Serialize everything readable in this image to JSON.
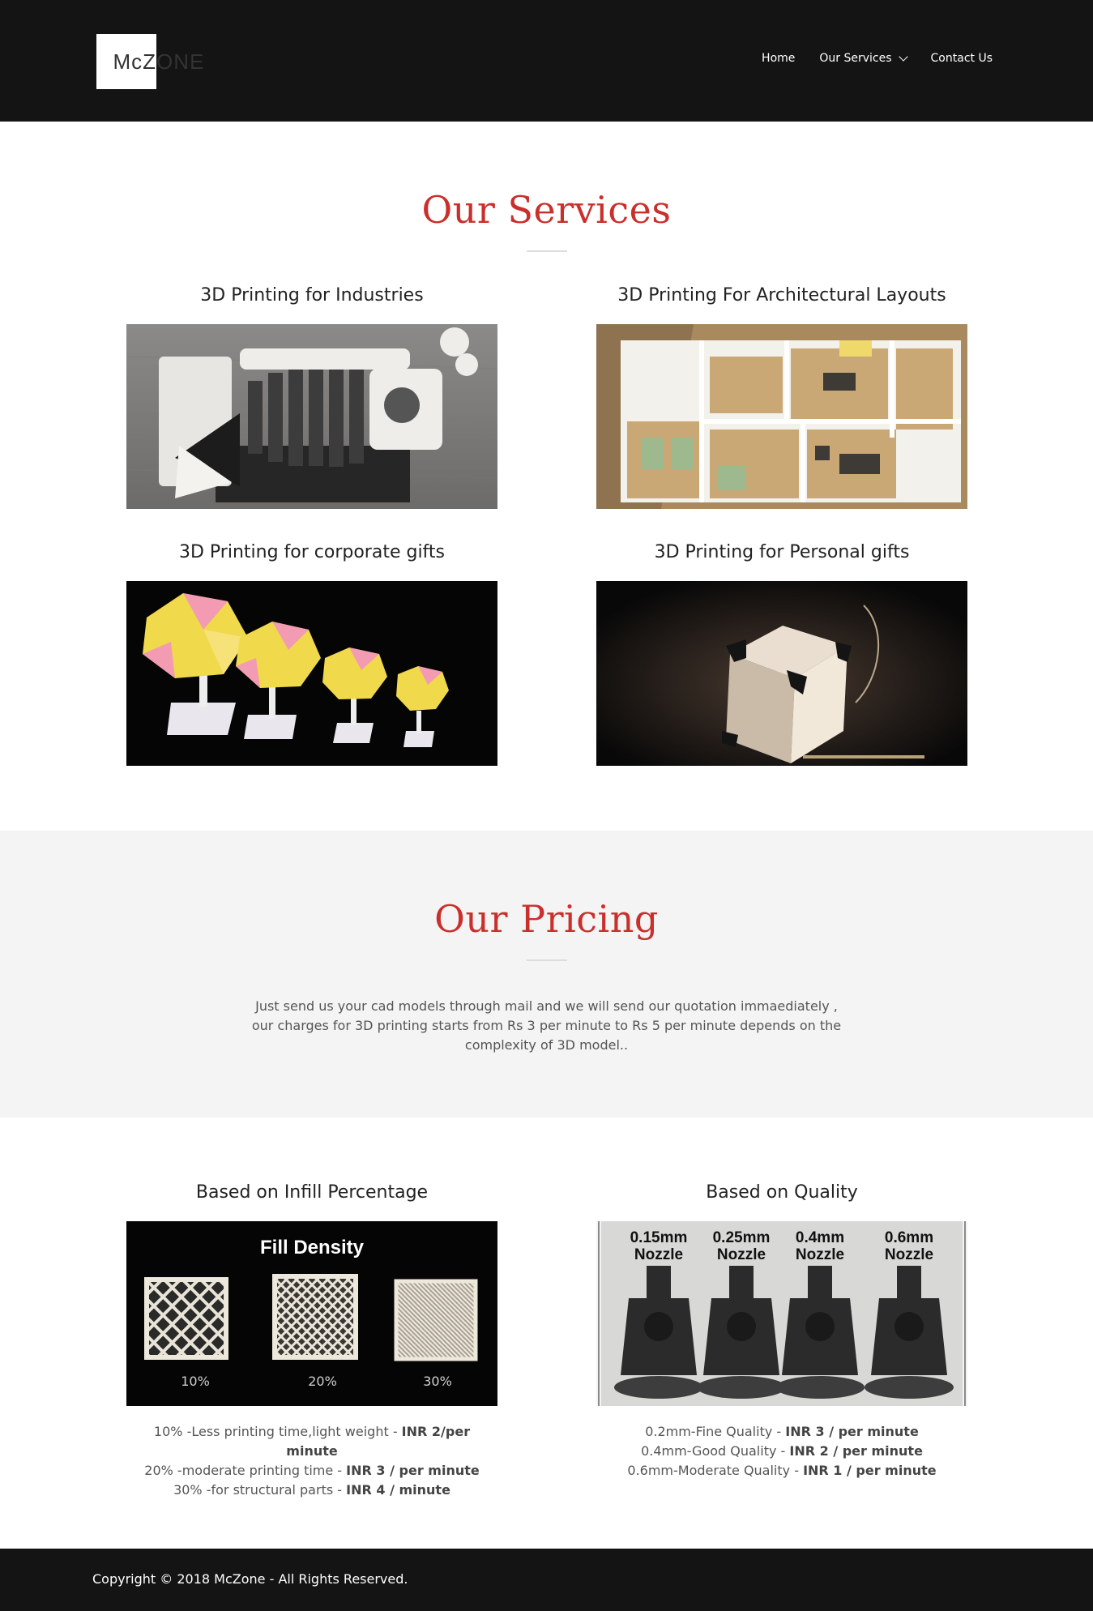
{
  "brand": {
    "logo_left": "McZ",
    "logo_right": "ONE"
  },
  "nav": {
    "home": "Home",
    "services": "Our Services",
    "contact": "Contact Us"
  },
  "services": {
    "title": "Our Services",
    "items": [
      {
        "title": "3D Printing for Industries",
        "image": "jet-engine-model"
      },
      {
        "title": "3D Printing For Architectural Layouts",
        "image": "floor-plan-model"
      },
      {
        "title": "3D Printing for corporate gifts",
        "image": "trophies"
      },
      {
        "title": "3D Printing for Personal gifts",
        "image": "lithophane-lamp"
      }
    ]
  },
  "pricing": {
    "title": "Our Pricing",
    "text": "Just send us your cad models through mail and we will send our quotation immaediately , our charges for 3D printing starts from Rs 3 per minute to Rs 5 per minute depends on the complexity of 3D model.."
  },
  "plans": {
    "infill": {
      "title": "Based on Infill Percentage",
      "image": {
        "heading": "Fill Density",
        "samples": [
          "10%",
          "20%",
          "30%"
        ]
      },
      "rows": [
        {
          "text": "10% -Less printing time,light weight - ",
          "price": "INR 2/per minute"
        },
        {
          "text": "20% -moderate printing time - ",
          "price": "INR 3 / per minute"
        },
        {
          "text": "30% -for structural parts - ",
          "price": "INR 4 / minute"
        }
      ]
    },
    "quality": {
      "title": "Based on Quality",
      "image": {
        "nozzles": [
          {
            "size": "0.15mm",
            "label": "Nozzle"
          },
          {
            "size": "0.25mm",
            "label": "Nozzle"
          },
          {
            "size": "0.4mm",
            "label": "Nozzle"
          },
          {
            "size": "0.6mm",
            "label": "Nozzle"
          }
        ]
      },
      "rows": [
        {
          "text": "0.2mm-Fine Quality - ",
          "price": "INR 3 / per minute"
        },
        {
          "text": "0.4mm-Good Quality - ",
          "price": "INR 2 / per minute"
        },
        {
          "text": "0.6mm-Moderate Quality - ",
          "price": "INR 1 / per minute"
        }
      ]
    }
  },
  "footer": {
    "copyright": "Copyright © 2018 McZone - All Rights Reserved."
  },
  "colors": {
    "accent": "#c9302c",
    "dark": "#141414",
    "light_bg": "#f4f4f4"
  }
}
